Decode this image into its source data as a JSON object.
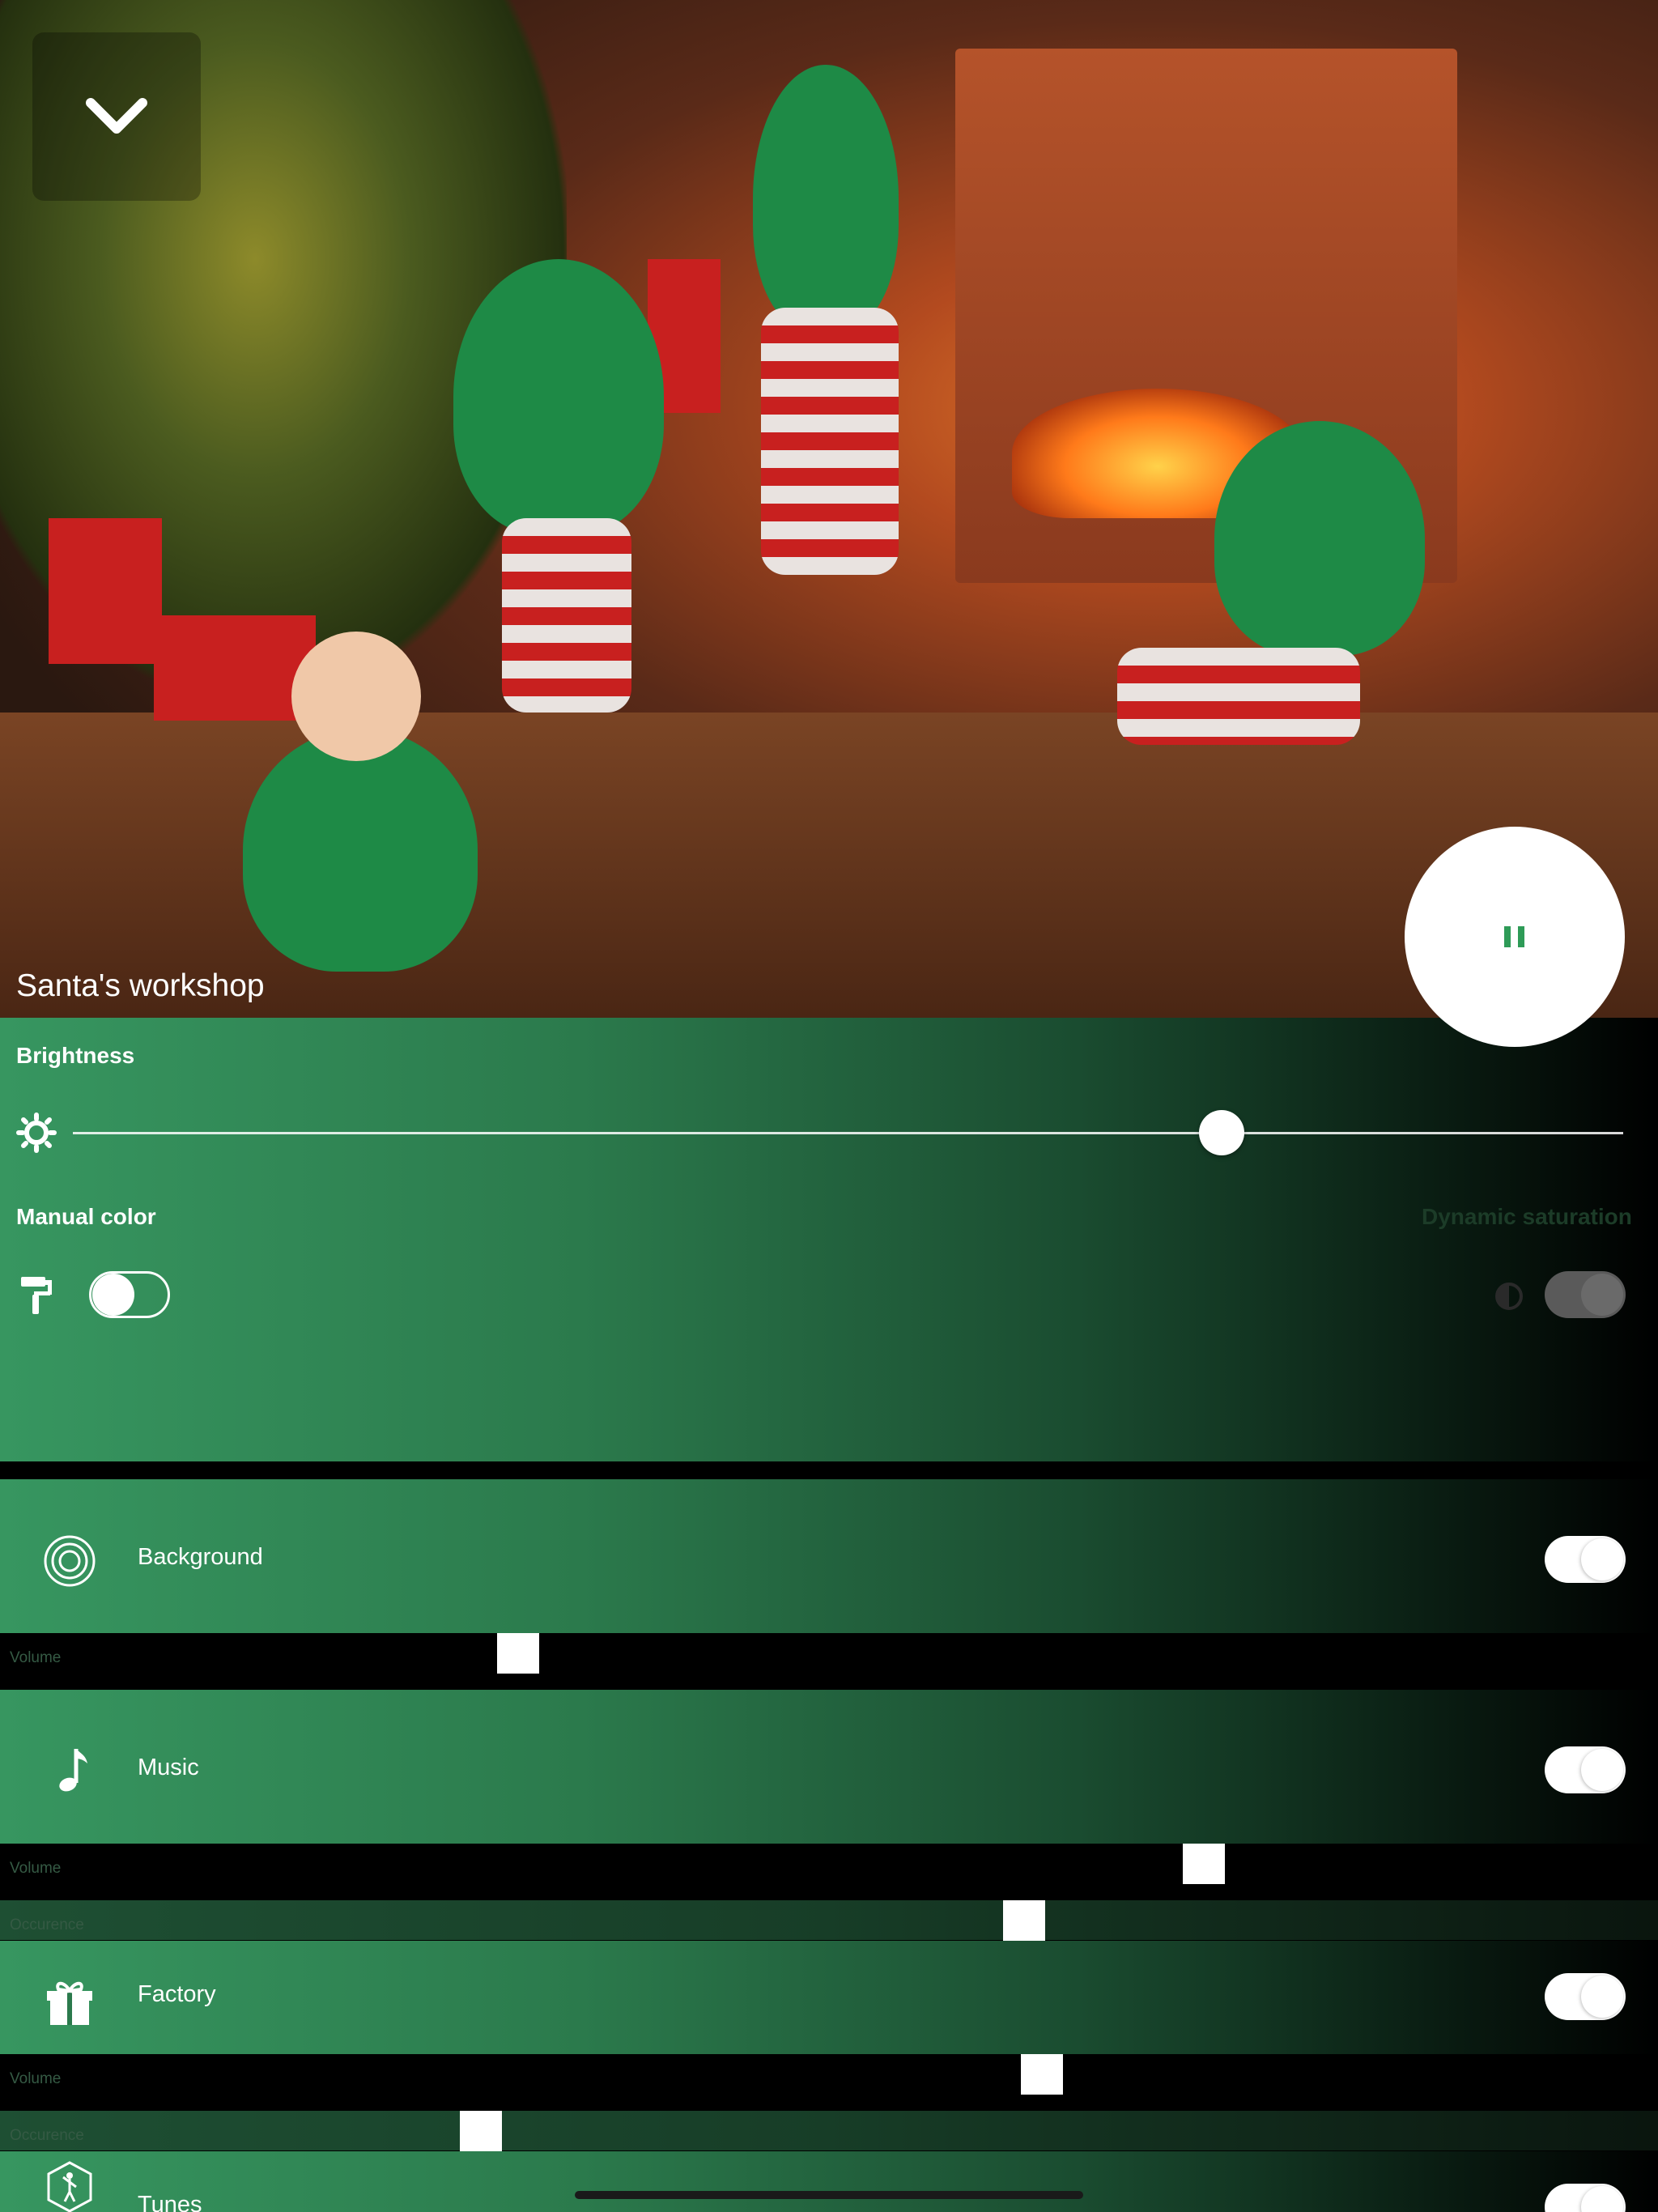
{
  "scene": {
    "title": "Santa's workshop",
    "playback": "paused"
  },
  "icons": {
    "collapse": "chevron-down-icon",
    "pause": "pause-icon",
    "brightness": "sun-icon",
    "manual_color": "paint-roller-icon",
    "dynamic_saturation": "contrast-icon"
  },
  "controls": {
    "brightness": {
      "label": "Brightness",
      "value_fraction": 0.74
    },
    "manual_color": {
      "label": "Manual color",
      "enabled": false
    },
    "dynamic_saturation": {
      "label": "Dynamic saturation",
      "enabled": true,
      "disabled": true
    }
  },
  "sounds": [
    {
      "name": "Background",
      "icon": "target-icon",
      "enabled": true,
      "volume_label": "Volume",
      "volume": 0.31
    },
    {
      "name": "Music",
      "icon": "music-note-icon",
      "enabled": true,
      "volume_label": "Volume",
      "volume": 0.73,
      "occurence_label": "Occurence",
      "occurence": 0.62
    },
    {
      "name": "Factory",
      "icon": "gift-icon",
      "enabled": true,
      "volume_label": "Volume",
      "volume": 0.63,
      "occurence_label": "Occurence",
      "occurence": 0.29
    },
    {
      "name": "Tunes",
      "icon": "dancer-icon",
      "enabled": true
    }
  ],
  "colors": {
    "accent_green": "#379660",
    "pause_icon": "#2e9b57"
  }
}
